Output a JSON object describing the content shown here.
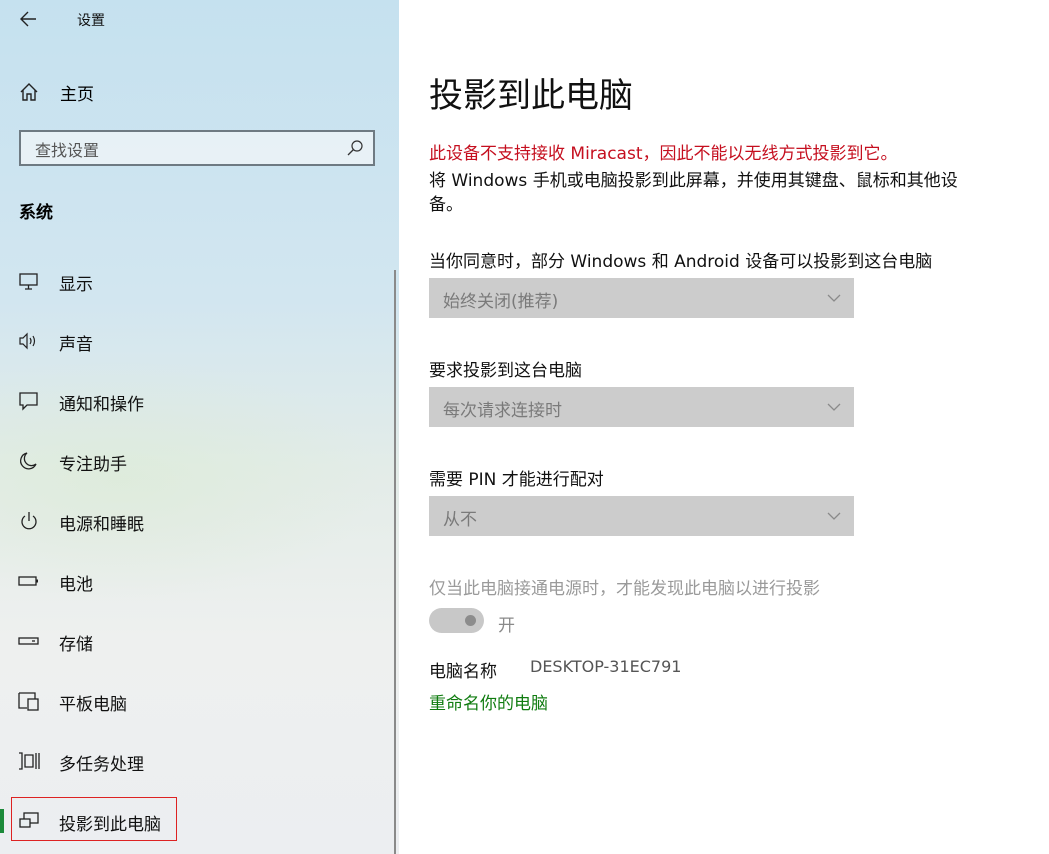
{
  "window": {
    "title": "设置"
  },
  "sidebar": {
    "home_label": "主页",
    "search_placeholder": "查找设置",
    "section_title": "系统",
    "items": [
      {
        "label": "显示",
        "icon": "monitor-icon"
      },
      {
        "label": "声音",
        "icon": "speaker-icon"
      },
      {
        "label": "通知和操作",
        "icon": "notification-icon"
      },
      {
        "label": "专注助手",
        "icon": "moon-icon"
      },
      {
        "label": "电源和睡眠",
        "icon": "power-icon"
      },
      {
        "label": "电池",
        "icon": "battery-icon"
      },
      {
        "label": "存储",
        "icon": "storage-icon"
      },
      {
        "label": "平板电脑",
        "icon": "tablet-icon"
      },
      {
        "label": "多任务处理",
        "icon": "multitask-icon"
      },
      {
        "label": "投影到此电脑",
        "icon": "project-icon",
        "active": true
      }
    ]
  },
  "main": {
    "title": "投影到此电脑",
    "warning": "此设备不支持接收 Miracast，因此不能以无线方式投影到它。",
    "description": "将 Windows 手机或电脑投影到此屏幕，并使用其键盘、鼠标和其他设备。",
    "setting1_label": "当你同意时，部分 Windows 和 Android 设备可以投影到这台电脑",
    "setting1_value": "始终关闭(推荐)",
    "setting2_label": "要求投影到这台电脑",
    "setting2_value": "每次请求连接时",
    "setting3_label": "需要 PIN 才能进行配对",
    "setting3_value": "从不",
    "power_label": "仅当此电脑接通电源时，才能发现此电脑以进行投影",
    "toggle_label": "开",
    "toggle_on": true,
    "pc_name_label": "电脑名称",
    "pc_name_value": "DESKTOP-31EC791",
    "rename_link": "重命名你的电脑"
  },
  "colors": {
    "warning": "#c50f1f",
    "link": "#107c10",
    "accent": "#1c8a3a"
  }
}
